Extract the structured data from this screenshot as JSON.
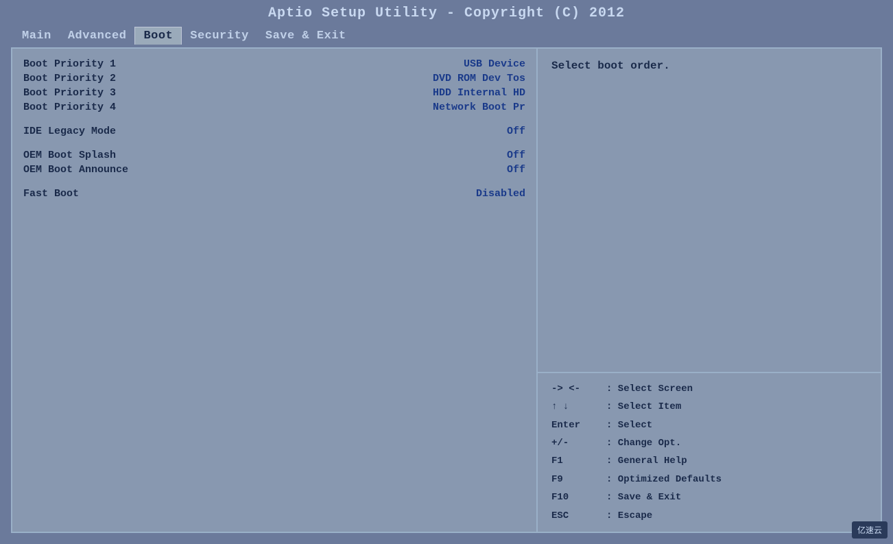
{
  "title": "Aptio Setup Utility - Copyright (C) 2012",
  "nav": {
    "items": [
      {
        "label": "Main",
        "active": false
      },
      {
        "label": "Advanced",
        "active": false
      },
      {
        "label": "Boot",
        "active": true
      },
      {
        "label": "Security",
        "active": false
      },
      {
        "label": "Save & Exit",
        "active": false
      }
    ]
  },
  "settings": [
    {
      "label": "Boot Priority 1",
      "value": "USB Device"
    },
    {
      "label": "Boot Priority 2",
      "value": "DVD ROM Dev Tos"
    },
    {
      "label": "Boot Priority 3",
      "value": "HDD Internal HD"
    },
    {
      "label": "Boot Priority 4",
      "value": "Network Boot Pr"
    },
    {
      "spacer": true
    },
    {
      "label": "IDE Legacy Mode",
      "value": "Off"
    },
    {
      "spacer": true
    },
    {
      "label": "OEM Boot Splash",
      "value": "Off"
    },
    {
      "label": "OEM Boot Announce",
      "value": "Off"
    },
    {
      "spacer": true
    },
    {
      "label": "Fast Boot",
      "value": "Disabled"
    }
  ],
  "help_text": "Select boot order.",
  "keybindings": [
    {
      "key": "-> <-",
      "desc": ": Select Screen"
    },
    {
      "key": "↑ ↓",
      "desc": ": Select Item"
    },
    {
      "key": "Enter",
      "desc": ": Select"
    },
    {
      "key": "+/-",
      "desc": ": Change Opt."
    },
    {
      "key": "F1",
      "desc": ": General Help"
    },
    {
      "key": "F9",
      "desc": ": Optimized Defaults"
    },
    {
      "key": "F10",
      "desc": ": Save & Exit"
    },
    {
      "key": "ESC",
      "desc": ": Escape"
    }
  ],
  "watermark": "亿速云"
}
